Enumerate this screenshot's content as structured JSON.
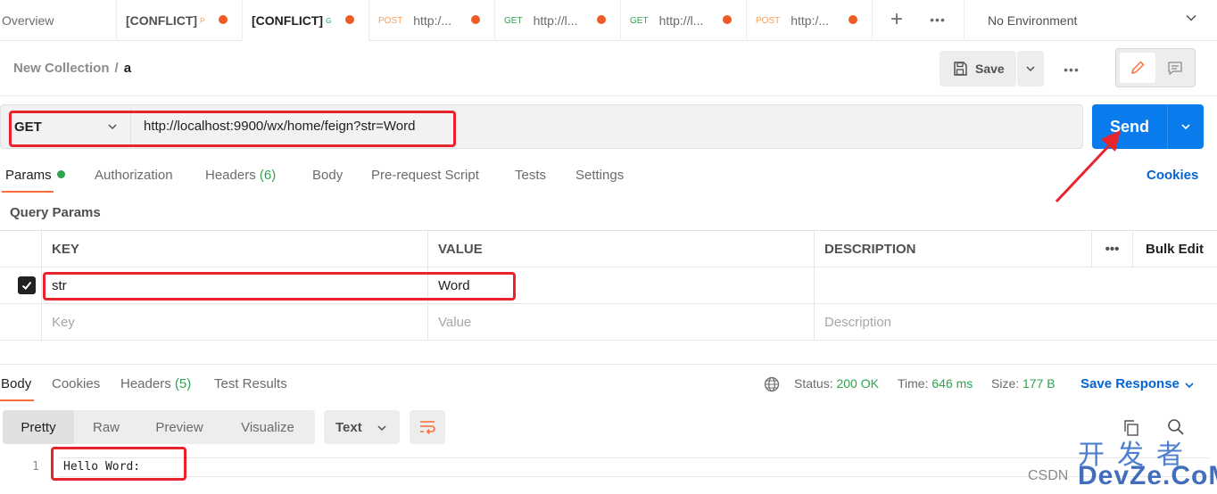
{
  "tabs": [
    {
      "title": "Overview"
    },
    {
      "conflict": "[CONFLICT]",
      "mini": "P",
      "mini_color": "#f5a05a",
      "unsaved": true
    },
    {
      "conflict": "[CONFLICT]",
      "mini": "G",
      "mini_color": "#2fa34e",
      "unsaved": true,
      "active": true
    },
    {
      "method": "POST",
      "title": "http:/...",
      "unsaved": true
    },
    {
      "method": "GET",
      "title": "http://l...",
      "unsaved": true
    },
    {
      "method": "GET",
      "title": "http://l...",
      "unsaved": true
    },
    {
      "method": "POST",
      "title": "http:/...",
      "unsaved": true
    }
  ],
  "environment": {
    "selected": "No Environment"
  },
  "breadcrumb": {
    "collection": "New Collection",
    "separator": "/",
    "request": "a"
  },
  "toolbar": {
    "save_label": "Save"
  },
  "request": {
    "method": "GET",
    "url": "http://localhost:9900/wx/home/feign?str=Word",
    "send_label": "Send"
  },
  "request_tabs": {
    "params": "Params",
    "authorization": "Authorization",
    "headers": "Headers",
    "headers_count": "(6)",
    "body": "Body",
    "prerequest": "Pre-request Script",
    "tests": "Tests",
    "settings": "Settings",
    "cookies": "Cookies"
  },
  "query_params": {
    "title": "Query Params",
    "columns": {
      "key": "KEY",
      "value": "VALUE",
      "description": "DESCRIPTION",
      "bulk_edit": "Bulk Edit"
    },
    "rows": [
      {
        "key": "str",
        "value": "Word",
        "checked": true
      }
    ],
    "placeholders": {
      "key": "Key",
      "value": "Value",
      "description": "Description"
    }
  },
  "response": {
    "tabs": {
      "body": "Body",
      "cookies": "Cookies",
      "headers": "Headers",
      "headers_count": "(5)",
      "test_results": "Test Results"
    },
    "status_label": "Status:",
    "status": "200 OK",
    "time_label": "Time:",
    "time": "646 ms",
    "size_label": "Size:",
    "size": "177 B",
    "save_response": "Save Response",
    "formats": [
      "Pretty",
      "Raw",
      "Preview",
      "Visualize"
    ],
    "active_format": "Pretty",
    "language": "Text",
    "lines": [
      {
        "number": "1",
        "text": "Hello Word:"
      }
    ]
  },
  "watermark": {
    "cn": "开发者",
    "csdn": "CSDN",
    "dev": "DevZe.CoM"
  },
  "colors": {
    "accent": "#ff6c37",
    "send": "#097bed",
    "link": "#0265d2",
    "success": "#2fa34e",
    "annotation": "#e8232b"
  }
}
